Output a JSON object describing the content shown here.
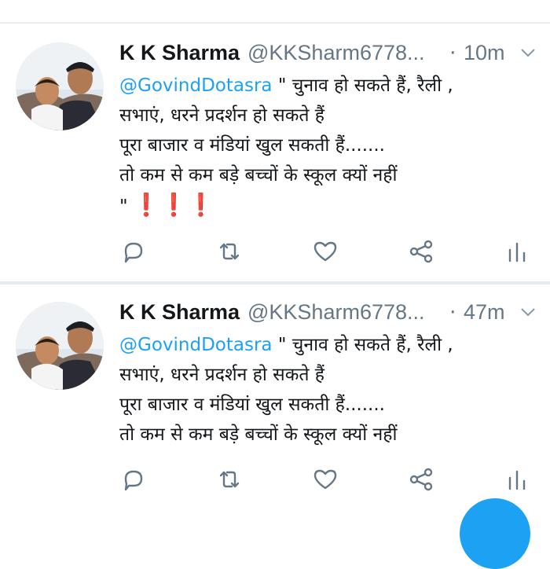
{
  "tweets": [
    {
      "name": "K K Sharma",
      "handle": "@KKSharm6778...",
      "dot": "·",
      "time": "10m",
      "mention": "@GovindDotasra",
      "line1_rest": " \" चुनाव हो सकते हैं, रैली ,",
      "line2": "सभाएं, धरने प्रदर्शन हो सकते हैं",
      "line3": "पूरा बाजार व मंडियां खुल सकती हैं.......",
      "line4": "तो कम से कम बड़े बच्चों के स्कूल क्यों नहीं",
      "line5_quote": "\"",
      "line5_marks": "❗❗❗",
      "icons": [
        "reply-icon",
        "retweet-icon",
        "like-icon",
        "share-icon",
        "analytics-icon"
      ]
    },
    {
      "name": "K K Sharma",
      "handle": "@KKSharm6778...",
      "dot": "·",
      "time": "47m",
      "mention": "@GovindDotasra",
      "line1_rest": " \" चुनाव हो सकते हैं, रैली ,",
      "line2": "सभाएं, धरने प्रदर्शन हो सकते हैं",
      "line3": "पूरा बाजार व मंडियां खुल सकती हैं.......",
      "line4": "तो कम से कम बड़े बच्चों के स्कूल क्यों नहीं",
      "icons": [
        "reply-icon",
        "retweet-icon",
        "like-icon",
        "share-icon",
        "analytics-icon"
      ]
    }
  ],
  "colors": {
    "accent": "#1da1f2",
    "text": "#14171a",
    "secondary": "#657786",
    "divider": "#e6ecf0",
    "exclamation": "#e0222f"
  }
}
